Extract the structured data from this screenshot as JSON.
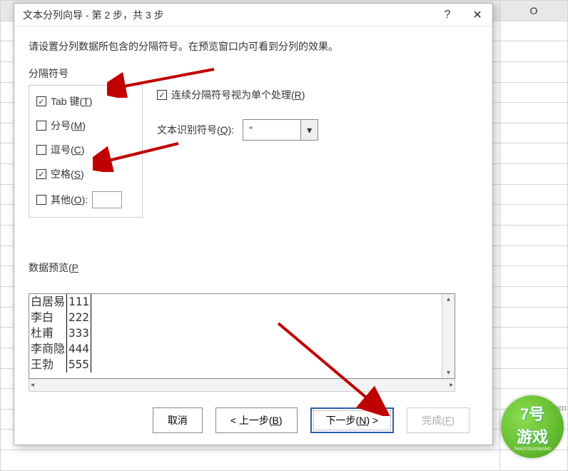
{
  "spreadsheet": {
    "col_headers": [
      "O"
    ]
  },
  "dialog": {
    "title": "文本分列向导 - 第 2 步，共 3 步",
    "help_symbol": "?",
    "close_symbol": "✕",
    "instruction": "请设置分列数据所包含的分隔符号。在预览窗口内可看到分列的效果。",
    "group_label": "分隔符号",
    "delimiters": {
      "tab": {
        "label_pre": "Tab 键(",
        "accel": "T",
        "label_post": ")",
        "checked": true
      },
      "semicolon": {
        "label_pre": "分号(",
        "accel": "M",
        "label_post": ")",
        "checked": false
      },
      "comma": {
        "label_pre": "逗号(",
        "accel": "C",
        "label_post": ")",
        "checked": false
      },
      "space": {
        "label_pre": "空格(",
        "accel": "S",
        "label_post": ")",
        "checked": true
      },
      "other": {
        "label_pre": "其他(",
        "accel": "O",
        "label_post": "):",
        "checked": false,
        "value": ""
      }
    },
    "consecutive": {
      "label_pre": "连续分隔符号视为单个处理(",
      "accel": "R",
      "label_post": ")",
      "checked": true
    },
    "qualifier": {
      "label_pre": "文本识别符号(",
      "accel": "Q",
      "label_post": "):",
      "value": "\"",
      "arrow": "▾"
    },
    "preview": {
      "label_pre": "数据预览(",
      "accel": "P",
      "label_post": ")",
      "rows": [
        {
          "c1": "白居易",
          "c2": "111"
        },
        {
          "c1": "李白",
          "c2": "222"
        },
        {
          "c1": "杜甫",
          "c2": "333"
        },
        {
          "c1": "李商隐",
          "c2": "444"
        },
        {
          "c1": "王勃",
          "c2": "555"
        }
      ],
      "scroll_up": "▴",
      "scroll_down": "▾",
      "scroll_left": "◂",
      "scroll_right": "▸"
    },
    "buttons": {
      "cancel": "取消",
      "back_pre": "< 上一步(",
      "back_accel": "B",
      "back_post": ")",
      "next_pre": "下一步(",
      "next_accel": "N",
      "next_post": ") >",
      "finish_pre": "完成(",
      "finish_accel": "F",
      "finish_post": ")"
    }
  },
  "watermark": {
    "line1": "7号",
    "line2": "游戏",
    "url": ".com",
    "sub": "7HAOYOUXIWANG"
  }
}
